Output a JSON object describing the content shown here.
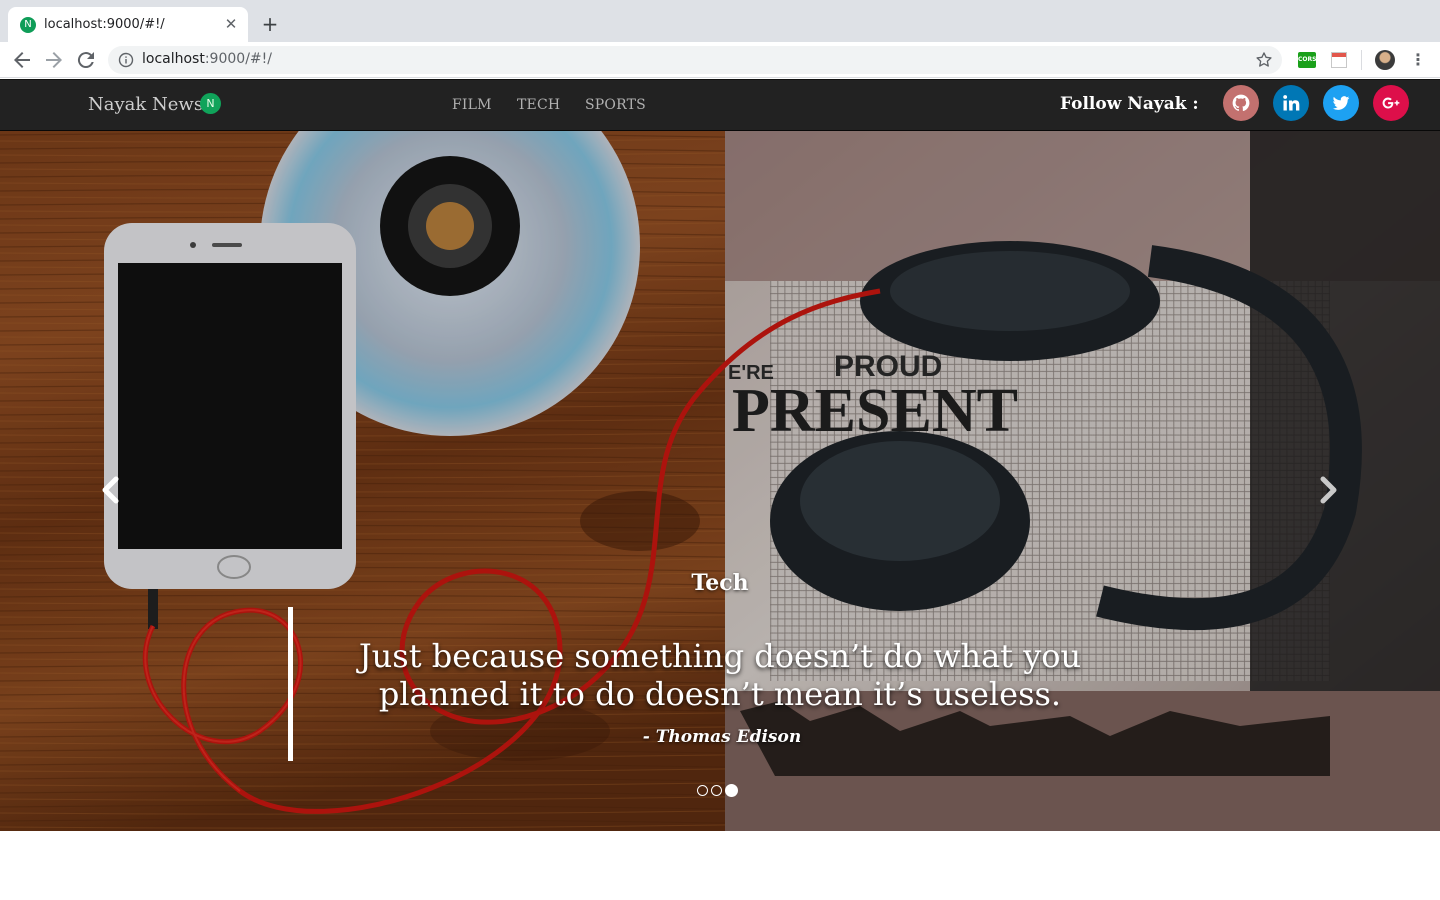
{
  "browser": {
    "tab_title": "localhost:9000/#!/",
    "tab_favicon_letter": "N",
    "url_host": "localhost",
    "url_rest": ":9000/#!/",
    "extensions": [
      "cors-extension-icon",
      "calendar-extension-icon"
    ],
    "ext_cors_label": "CORS"
  },
  "navbar": {
    "brand": "Nayak News",
    "brand_badge": "N",
    "links": [
      "FILM",
      "TECH",
      "SPORTS"
    ],
    "follow_label": "Follow Nayak :",
    "social": [
      {
        "name": "github",
        "color": "#c3716f"
      },
      {
        "name": "linkedin",
        "color": "#0077b5"
      },
      {
        "name": "twitter",
        "color": "#1da1f2"
      },
      {
        "name": "google-plus",
        "color": "#dd0f4a"
      }
    ]
  },
  "carousel": {
    "category": "Tech",
    "quote": "Just because something doesn’t do what you planned it to do doesn’t mean it’s useless.",
    "author": "- Thomas Edison",
    "slide_count": 3,
    "active_index": 2,
    "photo_text": {
      "line1": "PROUD",
      "line2": "PRESENT",
      "fragment": "E'RE"
    }
  }
}
